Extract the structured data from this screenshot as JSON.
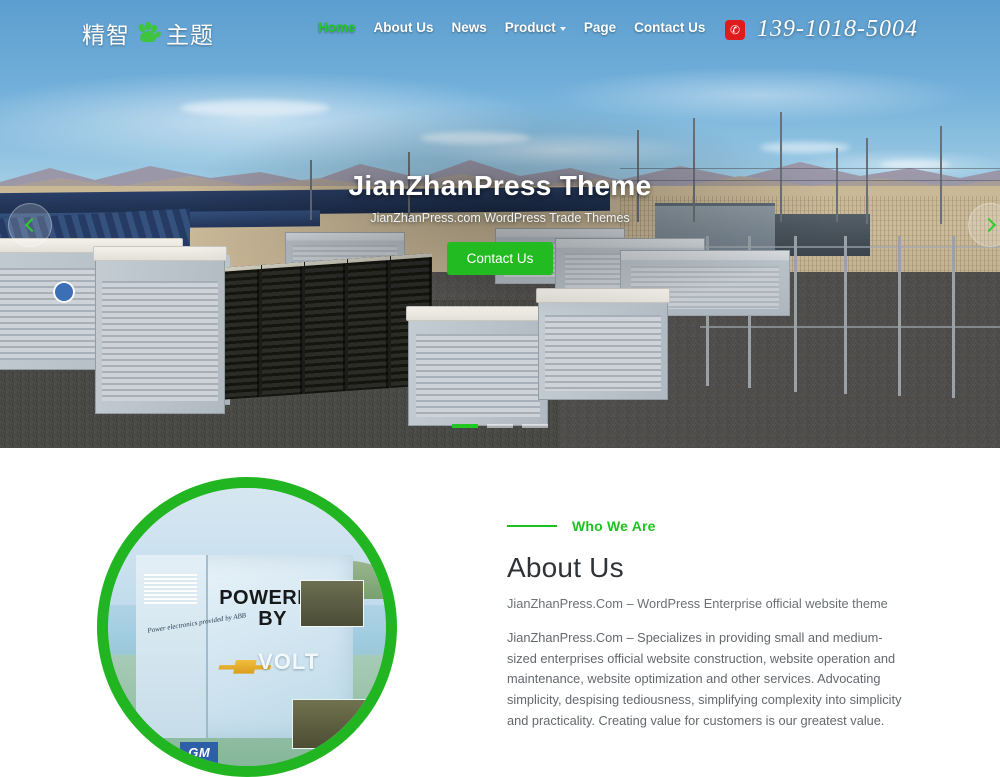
{
  "site": {
    "logo_text_left": "精智",
    "logo_icon": "paw-print-icon",
    "logo_text_right": "主题"
  },
  "nav": {
    "items": [
      {
        "label": "Home",
        "active": true,
        "dropdown": false
      },
      {
        "label": "About Us",
        "active": false,
        "dropdown": false
      },
      {
        "label": "News",
        "active": false,
        "dropdown": false
      },
      {
        "label": "Product",
        "active": false,
        "dropdown": true
      },
      {
        "label": "Page",
        "active": false,
        "dropdown": false
      },
      {
        "label": "Contact Us",
        "active": false,
        "dropdown": false
      }
    ]
  },
  "contact": {
    "phone_icon": "phone-icon",
    "phone_glyph": "✆",
    "phone_number": "139-1018-5004"
  },
  "hero": {
    "title": "JianZhanPress Theme",
    "subtitle": "JianZhanPress.com WordPress Trade Themes",
    "button_label": "Contact Us",
    "prev_label": "Previous slide",
    "next_label": "Next slide",
    "slide_count": 3,
    "active_slide": 1,
    "image_alt": "Desert grid-scale battery energy storage facility with GE containers, solar array and transmission poles"
  },
  "about": {
    "eyebrow": "Who We Are",
    "heading": "About Us",
    "lead": "JianZhanPress.Com – WordPress Enterprise official website theme",
    "paragraph": "JianZhanPress.Com – Specializes in providing small and medium-sized enterprises official website construction, website operation and maintenance, website optimization and other services. Advocating simplicity, despising tediousness, simplifying complexity into simplicity and practicality. Creating value for customers is our greatest value.",
    "image_alt": "Mobile battery energy storage container",
    "image_text": {
      "powered": "POWERED",
      "by": "BY",
      "volt": "VOLT",
      "abb": "Power electronics provided by ABB",
      "gm": "GM"
    }
  },
  "colors": {
    "accent_green": "#22bb22",
    "eyebrow_green": "#1fc11f",
    "phone_red": "#e01b1b",
    "heading_gray": "#2f3337",
    "body_gray": "#63686d"
  }
}
